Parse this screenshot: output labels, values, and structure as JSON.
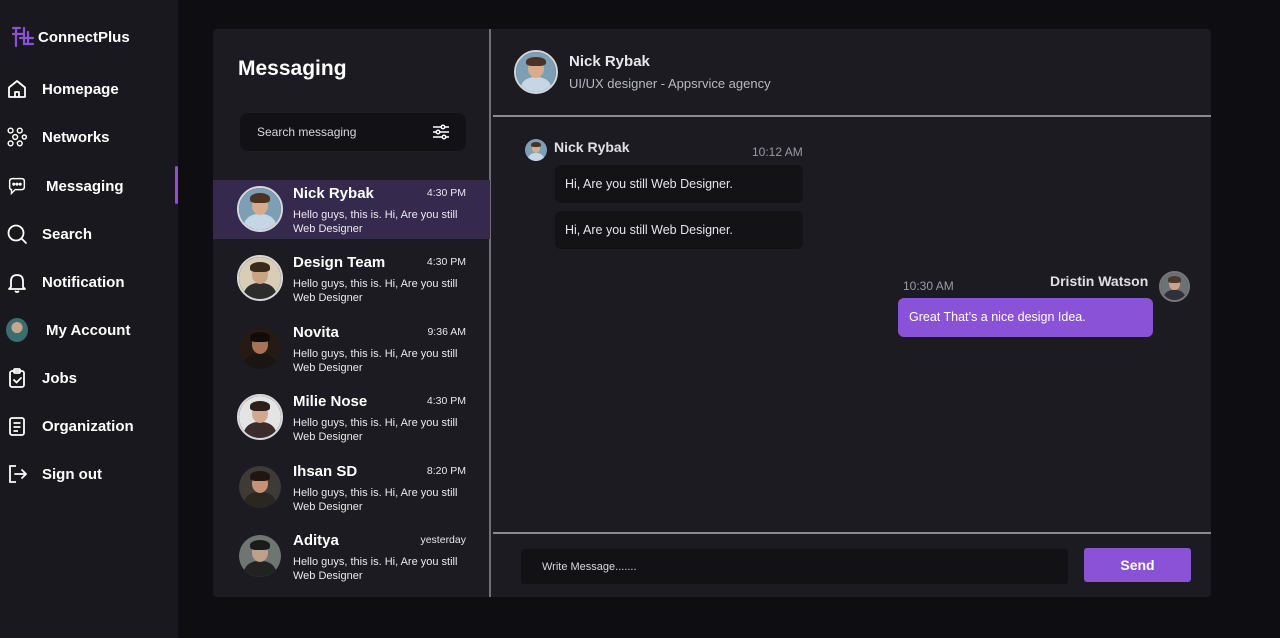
{
  "app": {
    "name": "ConnectPlus"
  },
  "sidebar": {
    "items": [
      {
        "label": "Homepage",
        "icon": "home-icon"
      },
      {
        "label": "Networks",
        "icon": "network-icon"
      },
      {
        "label": "Messaging",
        "icon": "chat-icon",
        "active": true
      },
      {
        "label": "Search",
        "icon": "search-icon"
      },
      {
        "label": "Notification",
        "icon": "bell-icon"
      },
      {
        "label": "My Account",
        "icon": "avatar"
      },
      {
        "label": "Jobs",
        "icon": "clipboard-check-icon"
      },
      {
        "label": "Organization",
        "icon": "document-icon"
      },
      {
        "label": "Sign out",
        "icon": "sign-out-icon"
      }
    ]
  },
  "messaging": {
    "title": "Messaging",
    "search_placeholder": "Search messaging",
    "conversations": [
      {
        "name": "Nick Rybak",
        "time": "4:30 PM",
        "preview": "Hello guys, this is. Hi, Are you still Web Designer",
        "active": true
      },
      {
        "name": "Design Team",
        "time": "4:30 PM",
        "preview": "Hello guys, this is. Hi, Are you still Web Designer"
      },
      {
        "name": "Novita",
        "time": "9:36 AM",
        "preview": "Hello guys, this is. Hi, Are you still Web Designer"
      },
      {
        "name": "Milie Nose",
        "time": "4:30 PM",
        "preview": "Hello guys, this is. Hi, Are you still Web Designer"
      },
      {
        "name": "Ihsan SD",
        "time": "8:20 PM",
        "preview": "Hello guys, this is. Hi, Are you still Web Designer"
      },
      {
        "name": "Aditya",
        "time": "yesterday",
        "preview": "Hello guys, this is. Hi, Are you still Web Designer"
      }
    ]
  },
  "chat": {
    "header": {
      "name": "Nick Rybak",
      "subtitle": "UI/UX designer - Appsrvice agency"
    },
    "incoming": {
      "sender": "Nick Rybak",
      "time": "10:12 AM",
      "messages": [
        "Hi, Are you still Web Designer.",
        "Hi, Are you still Web Designer."
      ]
    },
    "outgoing": {
      "sender": "Dristin Watson",
      "time": "10:30 AM",
      "message": "Great That’s a nice design Idea."
    },
    "compose_placeholder": "Write Message.......",
    "send_label": "Send"
  },
  "colors": {
    "accent": "#8a52d6",
    "active_row": "#35294d",
    "panel": "#1b1b21",
    "sidebar": "#18181e",
    "background": "#0e0e12"
  }
}
